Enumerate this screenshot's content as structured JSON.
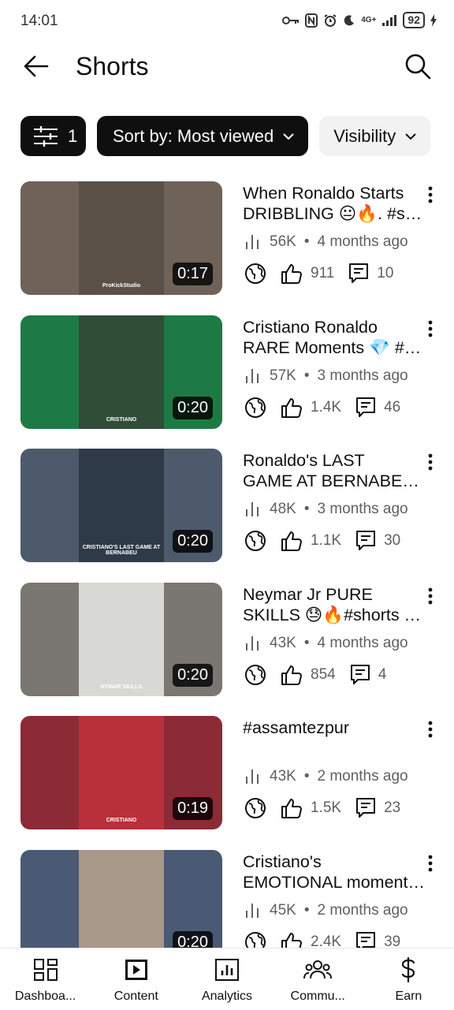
{
  "status_bar": {
    "time": "14:01",
    "battery": "92",
    "network": "4G+"
  },
  "header": {
    "title": "Shorts"
  },
  "chips": {
    "filter_count": "1",
    "sort_label": "Sort by: Most viewed",
    "visibility_label": "Visibility"
  },
  "videos": [
    {
      "title_l1": "When Ronaldo Starts",
      "title_l2": "DRIBBLING 😐🔥. #shorts",
      "views": "56K",
      "age": "4 months ago",
      "likes": "911",
      "comments": "10",
      "duration": "0:17",
      "thumb_bg": "#6e6259",
      "thumb_inner": "#5a5048",
      "thumb_caption": "ProKickStudio"
    },
    {
      "title_l1": "Cristiano Ronaldo",
      "title_l2": "RARE Moments 💎 #shorts",
      "views": "57K",
      "age": "3 months ago",
      "likes": "1.4K",
      "comments": "46",
      "duration": "0:20",
      "thumb_bg": "#1e7a44",
      "thumb_inner": "#2f4d37",
      "thumb_caption": "CRISTIANO"
    },
    {
      "title_l1": "Ronaldo's LAST",
      "title_l2": "GAME AT BERNABEU #shorts",
      "views": "48K",
      "age": "3 months ago",
      "likes": "1.1K",
      "comments": "30",
      "duration": "0:20",
      "thumb_bg": "#4d5a6c",
      "thumb_inner": "#2e3a48",
      "thumb_caption": "CRISTIANO'S LAST GAME AT BERNABEU"
    },
    {
      "title_l1": "Neymar Jr PURE",
      "title_l2": "SKILLS 😓🔥#shorts #neymar",
      "views": "43K",
      "age": "4 months ago",
      "likes": "854",
      "comments": "4",
      "duration": "0:20",
      "thumb_bg": "#7a7672",
      "thumb_inner": "#d8d8d4",
      "thumb_caption": "NYMAR SKILLS"
    },
    {
      "title_l1": "#assamtezpur",
      "title_l2": "",
      "views": "43K",
      "age": "2 months ago",
      "likes": "1.5K",
      "comments": "23",
      "duration": "0:19",
      "thumb_bg": "#8c2a36",
      "thumb_inner": "#b8303a",
      "thumb_caption": "CRISTIANO"
    },
    {
      "title_l1": "Cristiano's",
      "title_l2": "EMOTIONAL moments #shorts",
      "views": "45K",
      "age": "2 months ago",
      "likes": "2.4K",
      "comments": "39",
      "duration": "0:20",
      "thumb_bg": "#4a5a74",
      "thumb_inner": "#a89888",
      "thumb_caption": ""
    }
  ],
  "bottom_nav": [
    {
      "label": "Dashboa...",
      "icon": "dashboard-icon"
    },
    {
      "label": "Content",
      "icon": "content-icon"
    },
    {
      "label": "Analytics",
      "icon": "analytics-icon"
    },
    {
      "label": "Commu...",
      "icon": "community-icon"
    },
    {
      "label": "Earn",
      "icon": "earn-icon"
    }
  ]
}
